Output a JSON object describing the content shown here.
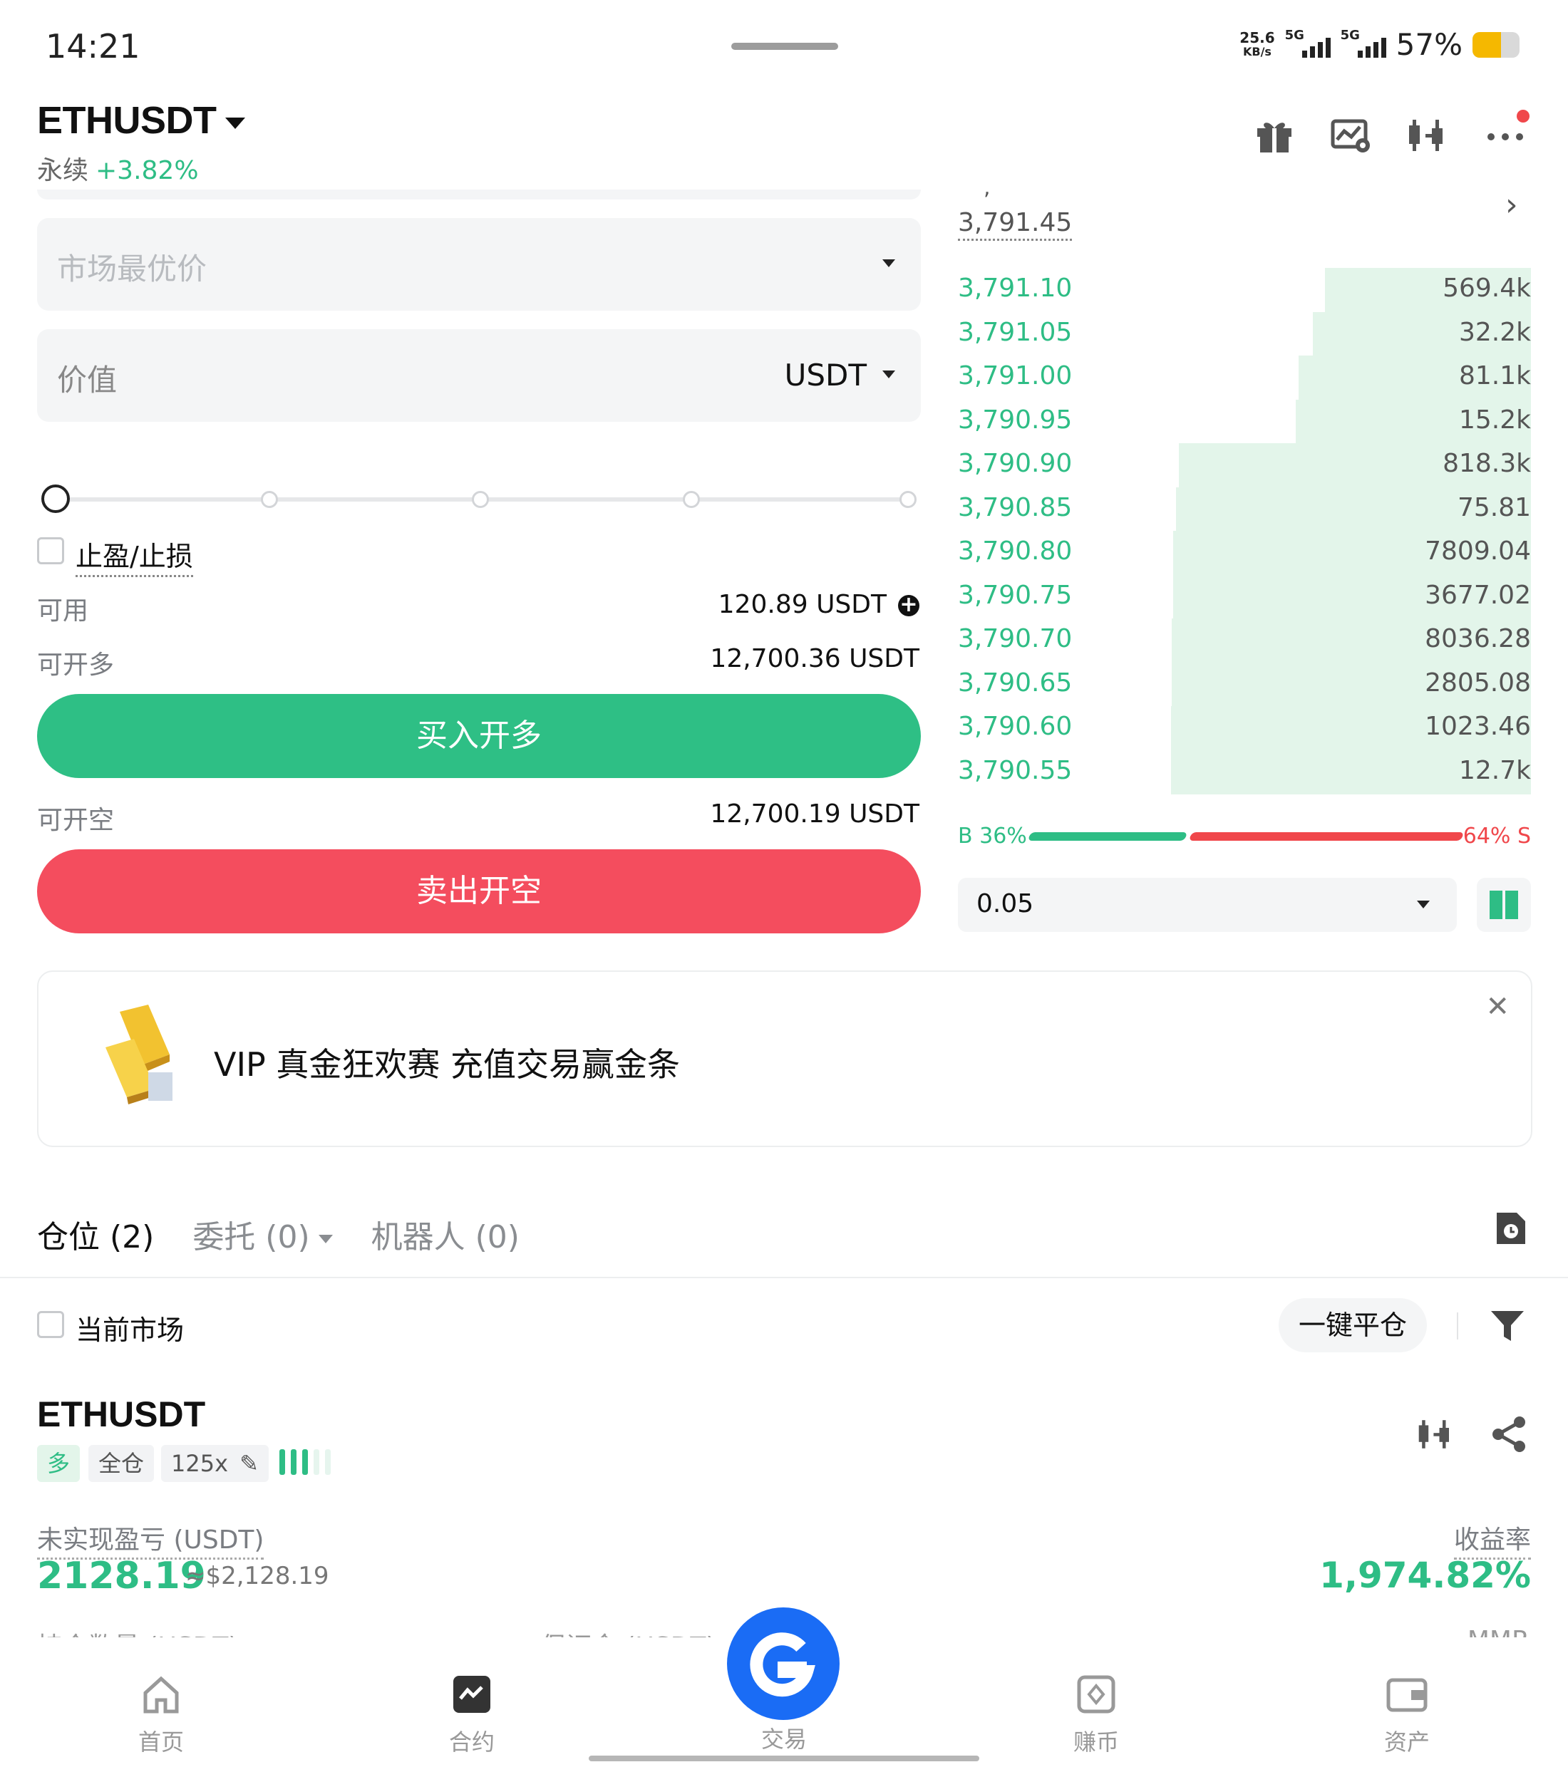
{
  "status_bar": {
    "time": "14:21",
    "net_rate_value": "25.6",
    "net_rate_unit": "KB/s",
    "sim1": "5G",
    "sim2": "5G",
    "battery": "57%"
  },
  "header": {
    "symbol": "ETHUSDT",
    "contract_type": "永续",
    "change": "+3.82%"
  },
  "order_form": {
    "order_type_placeholder": "市场最优价",
    "value_label": "价值",
    "value_unit": "USDT",
    "tpsl_label": "止盈/止损",
    "available_label": "可用",
    "available_value": "120.89 USDT",
    "max_long_label": "可开多",
    "max_long_value": "12,700.36 USDT",
    "buy_button": "买入开多",
    "max_short_label": "可开空",
    "max_short_value": "12,700.19 USDT",
    "sell_button": "卖出开空",
    "slider_value_percent": 0
  },
  "order_book": {
    "last_price": "3,791.45",
    "bids": [
      {
        "price": "3,791.10",
        "qty": "569.4k",
        "depth": 0.36
      },
      {
        "price": "3,791.05",
        "qty": "32.2k",
        "depth": 0.38
      },
      {
        "price": "3,791.00",
        "qty": "81.1k",
        "depth": 0.405
      },
      {
        "price": "3,790.95",
        "qty": "15.2k",
        "depth": 0.41
      },
      {
        "price": "3,790.90",
        "qty": "818.3k",
        "depth": 0.615
      },
      {
        "price": "3,790.85",
        "qty": "75.81",
        "depth": 0.62
      },
      {
        "price": "3,790.80",
        "qty": "7809.04",
        "depth": 0.625
      },
      {
        "price": "3,790.75",
        "qty": "3677.02",
        "depth": 0.625
      },
      {
        "price": "3,790.70",
        "qty": "8036.28",
        "depth": 0.627
      },
      {
        "price": "3,790.65",
        "qty": "2805.08",
        "depth": 0.627
      },
      {
        "price": "3,790.60",
        "qty": "1023.46",
        "depth": 0.628
      },
      {
        "price": "3,790.55",
        "qty": "12.7k",
        "depth": 0.628
      }
    ],
    "buy_ratio": "B 36%",
    "sell_ratio": "64% S",
    "precision": "0.05"
  },
  "banner": {
    "title": "VIP 真金狂欢赛 充值交易赢金条"
  },
  "positions": {
    "tabs": [
      {
        "label": "仓位 (2)"
      },
      {
        "label": "委托 (0)"
      },
      {
        "label": "机器人 (0)"
      }
    ],
    "current_market_label": "当前市场",
    "close_all_button": "一键平仓",
    "item": {
      "symbol": "ETHUSDT",
      "side": "多",
      "margin_mode": "全仓",
      "leverage": "125x",
      "pnl_label": "未实现盈亏 (USDT)",
      "pnl_value": "2128.19",
      "pnl_usd": "≈$2,128.19",
      "roi_label": "收益率",
      "roi_value": "1,974.82%",
      "next_row_labels": [
        "持仓数量 (USDT)",
        "保证金 (USDT)",
        "MMR"
      ]
    }
  },
  "bottom_nav": {
    "items": [
      {
        "label": "首页",
        "icon": "home-icon"
      },
      {
        "label": "合约",
        "icon": "futures-icon"
      },
      {
        "label": "交易",
        "icon": "trade-icon"
      },
      {
        "label": "赚币",
        "icon": "earn-icon"
      },
      {
        "label": "资产",
        "icon": "wallet-icon"
      }
    ]
  },
  "colors": {
    "green": "#2ebd85",
    "red": "#f44d5e",
    "blue": "#1a6cf5"
  }
}
